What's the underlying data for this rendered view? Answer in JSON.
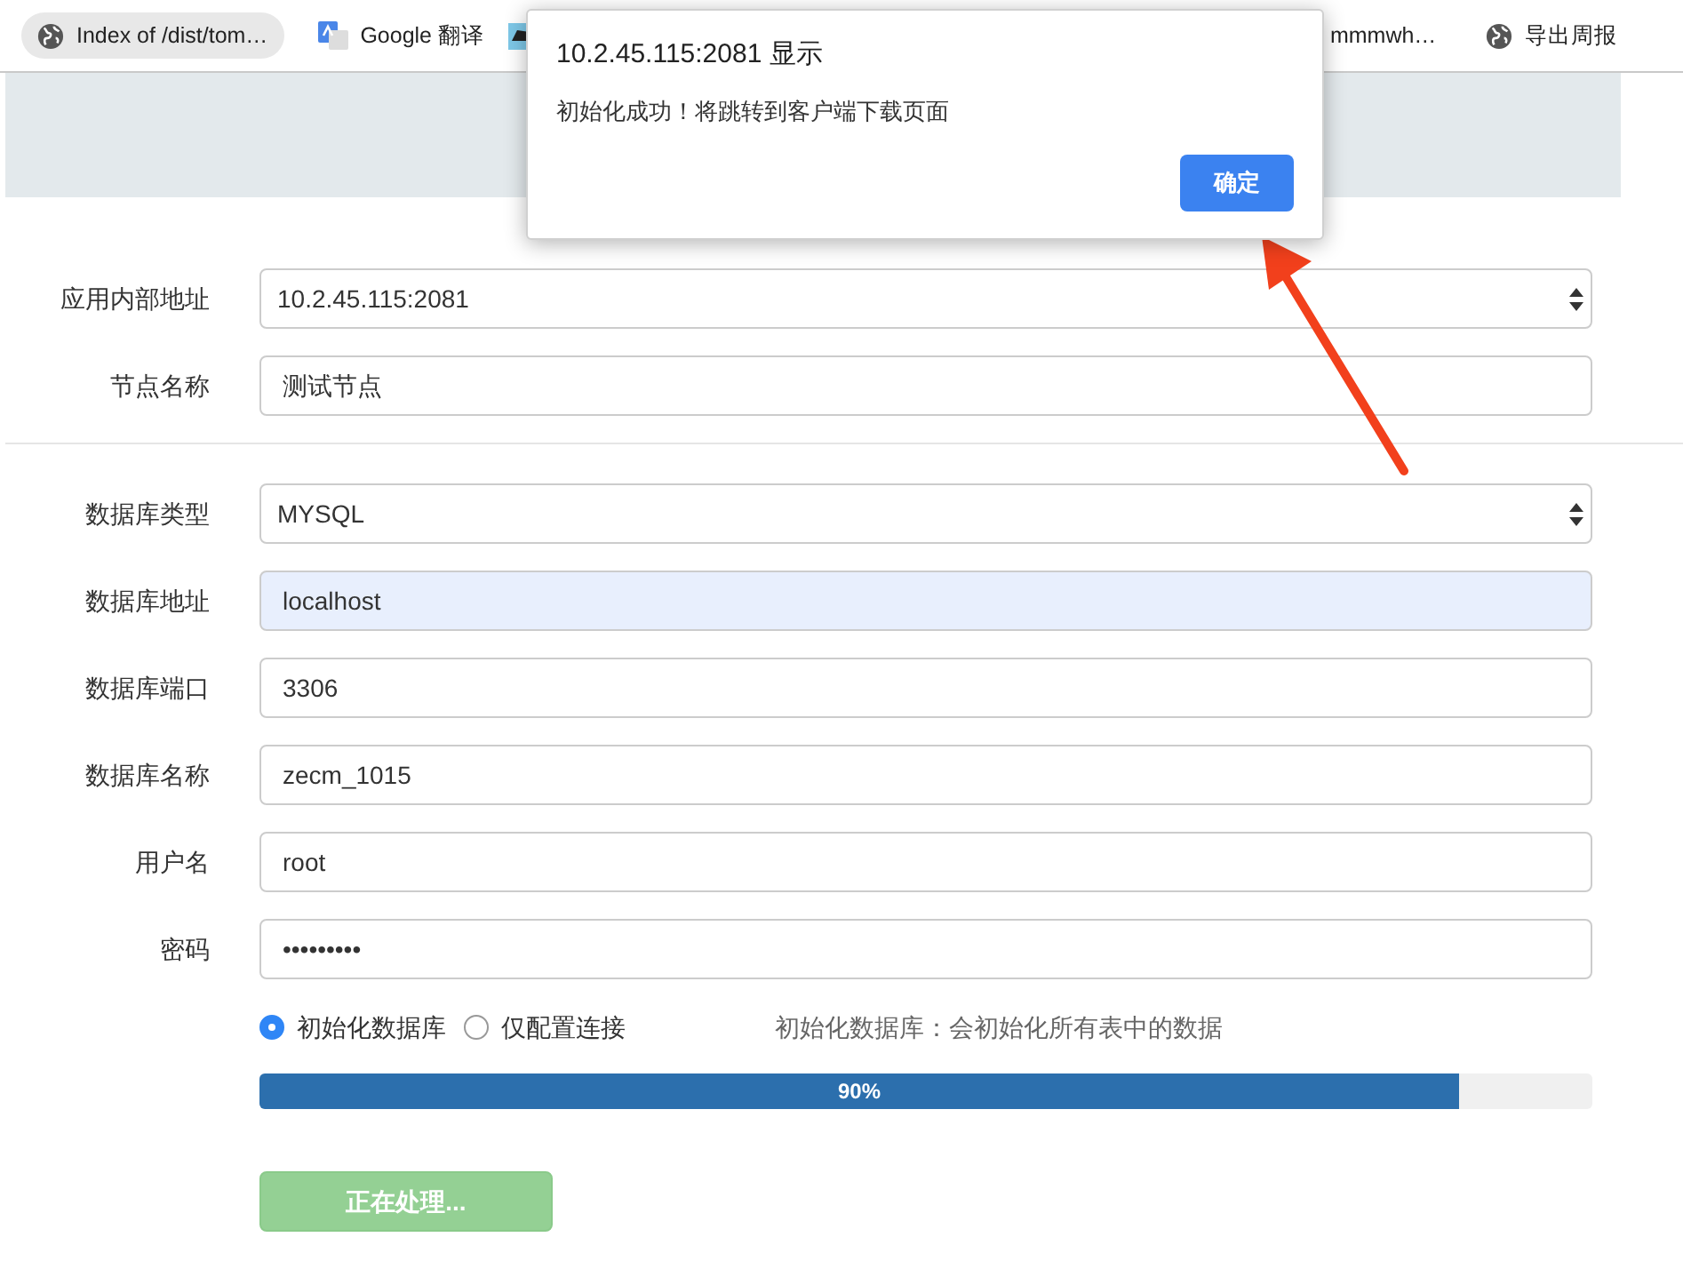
{
  "bookmarks": [
    {
      "kind": "globe",
      "label": "Index of /dist/tom…",
      "selected": true
    },
    {
      "kind": "translate",
      "label": "Google 翻译",
      "selected": false
    },
    {
      "kind": "partial"
    },
    {
      "kind": "none",
      "label": "mmmwh…",
      "selected": false
    },
    {
      "kind": "globe",
      "label": "导出周报",
      "selected": false
    }
  ],
  "dialog": {
    "title": "10.2.45.115:2081 显示",
    "message": "初始化成功！将跳转到客户端下载页面",
    "button": "确定"
  },
  "form_groups": [
    {
      "fields": [
        {
          "kind": "select",
          "label": "应用内部地址",
          "value": "10.2.45.115:2081",
          "autofilled": false
        },
        {
          "kind": "input",
          "label": "节点名称",
          "value": "测试节点",
          "autofilled": false
        }
      ]
    },
    {
      "fields": [
        {
          "kind": "select",
          "label": "数据库类型",
          "value": "MYSQL",
          "autofilled": false
        },
        {
          "kind": "input",
          "label": "数据库地址",
          "value": "localhost",
          "autofilled": true
        },
        {
          "kind": "input",
          "label": "数据库端口",
          "value": "3306",
          "autofilled": false
        },
        {
          "kind": "input",
          "label": "数据库名称",
          "value": "zecm_1015",
          "autofilled": false
        },
        {
          "kind": "input",
          "label": "用户名",
          "value": "root",
          "autofilled": false
        },
        {
          "kind": "input",
          "label": "密码",
          "value": "•••••••••",
          "autofilled": false
        }
      ]
    }
  ],
  "init_options": [
    {
      "label": "初始化数据库",
      "selected": true
    },
    {
      "label": "仅配置连接",
      "selected": false
    }
  ],
  "init_hint": "初始化数据库：会初始化所有表中的数据",
  "progress": {
    "level": 0.9,
    "label": "90%"
  },
  "submit": {
    "label": "正在处理...",
    "disabled": true
  }
}
